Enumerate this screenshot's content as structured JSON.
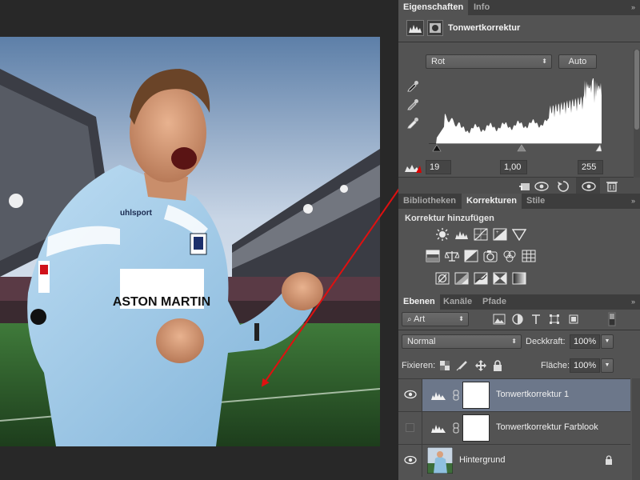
{
  "properties": {
    "tabs": [
      {
        "label": "Eigenschaften",
        "active": true
      },
      {
        "label": "Info",
        "active": false
      }
    ],
    "title": "Tonwertkorrektur",
    "channel": "Rot",
    "auto_label": "Auto",
    "input_black": "19",
    "gamma": "1,00",
    "input_white": "255"
  },
  "adjustments": {
    "tabs": [
      {
        "label": "Bibliotheken",
        "active": false
      },
      {
        "label": "Korrekturen",
        "active": true
      },
      {
        "label": "Stile",
        "active": false
      }
    ],
    "heading": "Korrektur hinzufügen"
  },
  "layers": {
    "tabs": [
      {
        "label": "Ebenen",
        "active": true
      },
      {
        "label": "Kanäle",
        "active": false
      },
      {
        "label": "Pfade",
        "active": false
      }
    ],
    "filter_kind": "Art",
    "blend_mode": "Normal",
    "opacity_label": "Deckkraft:",
    "opacity": "100%",
    "lock_label": "Fixieren:",
    "fill_label": "Fläche:",
    "fill": "100%",
    "items": [
      {
        "name": "Tonwertkorrektur 1",
        "visible": true,
        "selected": true
      },
      {
        "name": "Tonwertkorrektur Farblook",
        "visible": false,
        "selected": false
      },
      {
        "name": "Hintergrund",
        "visible": true,
        "selected": false,
        "locked": true
      }
    ]
  },
  "photo": {
    "jersey_brand": "uhlsport",
    "sponsor": "ASTON MARTIN",
    "sleeve_badge": "BUNDES LIGA"
  },
  "colors": {
    "panel_bg": "#535353",
    "tab_bar": "#3d3d3d",
    "selected_layer": "#6c778a",
    "annotation_arrow": "#e01010"
  }
}
